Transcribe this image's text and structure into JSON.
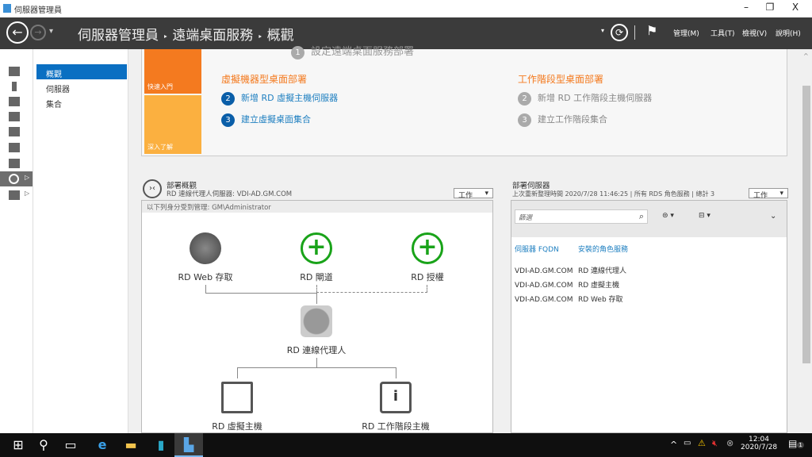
{
  "window": {
    "title": "伺服器管理員",
    "min": "–",
    "max": "❐",
    "close": "X"
  },
  "header": {
    "breadcrumb": [
      "伺服器管理員",
      "遠端桌面服務",
      "概觀"
    ],
    "sep": "‣",
    "menus": [
      "管理(M)",
      "工具(T)",
      "檢視(V)",
      "說明(H)"
    ]
  },
  "nav": {
    "items": [
      {
        "label": "概觀",
        "selected": true
      },
      {
        "label": "伺服器"
      },
      {
        "label": "集合"
      }
    ]
  },
  "quickstart": {
    "top_step": {
      "num": "1",
      "label": "設定遠端桌面服務部署"
    },
    "tiles": [
      "快速入門",
      "深入了解"
    ],
    "vm": {
      "title": "虛擬機器型桌面部署",
      "steps": [
        {
          "num": "2",
          "label": "新增 RD 虛擬主機伺服器"
        },
        {
          "num": "3",
          "label": "建立虛擬桌面集合"
        }
      ]
    },
    "session": {
      "title": "工作階段型桌面部署",
      "steps": [
        {
          "num": "2",
          "label": "新增 RD 工作階段主機伺服器"
        },
        {
          "num": "3",
          "label": "建立工作階段集合"
        }
      ]
    }
  },
  "overview": {
    "title": "部署概觀",
    "subtitle": "RD 連線代理人伺服器: VDI-AD.GM.COM",
    "tasks": "工作",
    "managed_by": "以下列身分受到管理: GM\\Administrator",
    "nodes": {
      "web": "RD Web 存取",
      "gateway": "RD 閘道",
      "license": "RD 授權",
      "broker": "RD 連線代理人",
      "vh": "RD 虛擬主機",
      "sh": "RD 工作階段主機"
    }
  },
  "servers": {
    "title": "部署伺服器",
    "subtitle": "上次重新整理時間 2020/7/28 11:46:25 | 所有 RDS 角色服務 | 總計 3",
    "tasks": "工作",
    "filter_placeholder": "篩選",
    "columns": [
      "伺服器 FQDN",
      "安裝的角色服務"
    ],
    "rows": [
      [
        "VDI-AD.GM.COM",
        "RD 連線代理人"
      ],
      [
        "VDI-AD.GM.COM",
        "RD 虛擬主機"
      ],
      [
        "VDI-AD.GM.COM",
        "RD Web 存取"
      ]
    ]
  },
  "taskbar": {
    "time": "12:04",
    "date": "2020/7/28",
    "notifications": "1"
  },
  "colors": {
    "header": "#3b3b3b",
    "accent": "#0a6fc2",
    "orange": "#f47a1f",
    "light_orange": "#fbb040",
    "green": "#19a319"
  }
}
